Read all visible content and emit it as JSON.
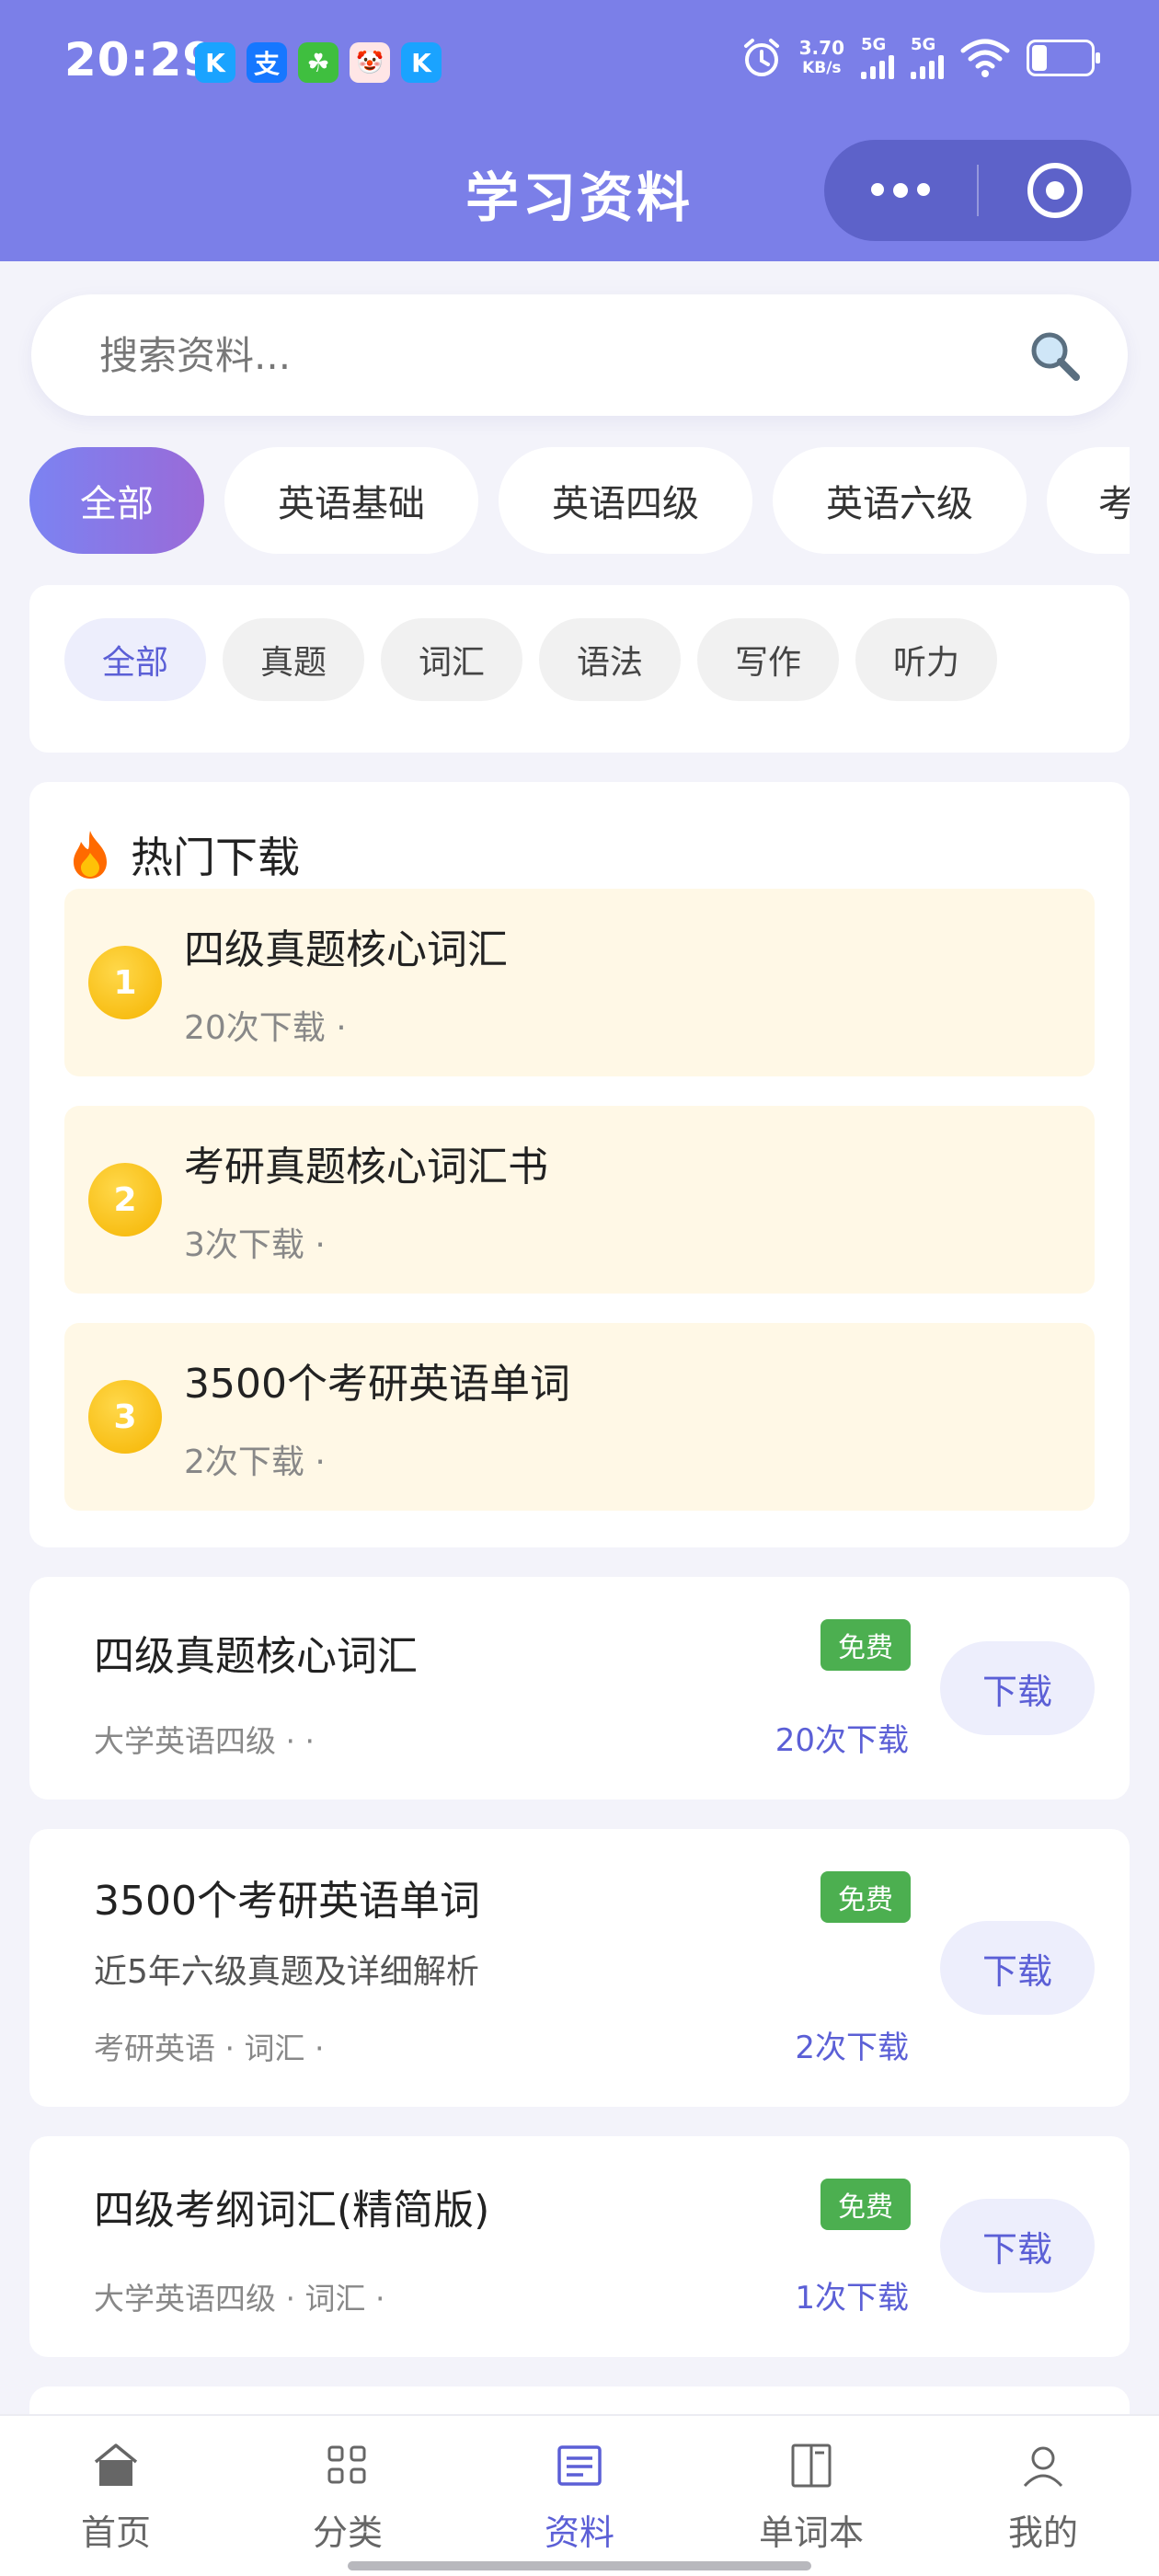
{
  "status_bar": {
    "time": "20:29",
    "app_icons": [
      "K",
      "支",
      "☘",
      "🤡",
      "K"
    ],
    "net_speed_value": "3.70",
    "net_speed_unit": "KB/s",
    "signal1_label": "5G",
    "signal2_label": "5G",
    "battery_level": 0.25
  },
  "nav": {
    "title": "学习资料"
  },
  "search": {
    "placeholder": "搜索资料..."
  },
  "categories": [
    {
      "label": "全部",
      "active": true
    },
    {
      "label": "英语基础",
      "active": false
    },
    {
      "label": "英语四级",
      "active": false
    },
    {
      "label": "英语六级",
      "active": false
    },
    {
      "label": "考",
      "active": false
    }
  ],
  "tags": [
    {
      "label": "全部",
      "active": true
    },
    {
      "label": "真题",
      "active": false
    },
    {
      "label": "词汇",
      "active": false
    },
    {
      "label": "语法",
      "active": false
    },
    {
      "label": "写作",
      "active": false
    },
    {
      "label": "听力",
      "active": false
    }
  ],
  "hot": {
    "icon": "fire-icon",
    "title": "热门下载",
    "items": [
      {
        "rank": "1",
        "name": "四级真题核心词汇",
        "meta": "20次下载 ·"
      },
      {
        "rank": "2",
        "name": "考研真题核心词汇书",
        "meta": "3次下载 ·"
      },
      {
        "rank": "3",
        "name": "3500个考研英语单词",
        "meta": "2次下载 ·"
      }
    ]
  },
  "resources": [
    {
      "title": "四级真题核心词汇",
      "badge": "免费",
      "desc": "",
      "meta": "大学英语四级 · ·",
      "count": "20次下载",
      "button": "下载"
    },
    {
      "title": "3500个考研英语单词",
      "badge": "免费",
      "desc": "近5年六级真题及详细解析",
      "meta": "考研英语 · 词汇 ·",
      "count": "2次下载",
      "button": "下载"
    },
    {
      "title": "四级考纲词汇(精简版)",
      "badge": "免费",
      "desc": "",
      "meta": "大学英语四级 · 词汇 ·",
      "count": "1次下载",
      "button": "下载"
    }
  ],
  "tabbar": [
    {
      "label": "首页",
      "icon": "home-icon",
      "active": false
    },
    {
      "label": "分类",
      "icon": "grid-icon",
      "active": false
    },
    {
      "label": "资料",
      "icon": "document-icon",
      "active": true
    },
    {
      "label": "单词本",
      "icon": "book-icon",
      "active": false
    },
    {
      "label": "我的",
      "icon": "user-icon",
      "active": false
    }
  ],
  "colors": {
    "header": "#7b7fe8",
    "accent": "#5b5fd6",
    "free_badge": "#4caf50",
    "hot_bg": "#fff8e6"
  }
}
